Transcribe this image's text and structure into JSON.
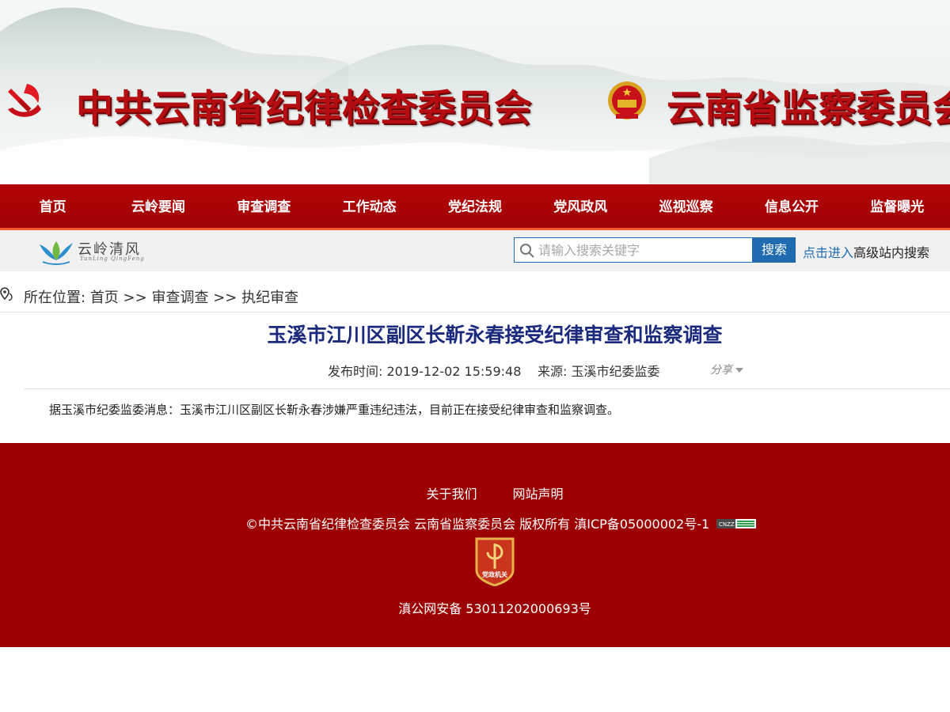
{
  "banner": {
    "title_left": "中共云南省纪律检查委员会",
    "title_right": "云南省监察委员会",
    "party_emblem_icon": "party-emblem-icon",
    "state_emblem_icon": "national-emblem-icon"
  },
  "nav": {
    "items": [
      "首页",
      "云岭要闻",
      "审查调查",
      "工作动态",
      "党纪法规",
      "党风政风",
      "巡视巡察",
      "信息公开",
      "监督曝光"
    ]
  },
  "subbar": {
    "logo_text": "云岭清风",
    "logo_sub": "YunLing QingFeng",
    "search_placeholder": "请输入搜索关键字",
    "search_button": "搜索",
    "advanced_link": "点击进入",
    "advanced_text": "高级站内搜索"
  },
  "breadcrumb": {
    "label": "所在位置:",
    "items": [
      "首页",
      "审查调查",
      "执纪审查"
    ],
    "separator": ">>"
  },
  "article": {
    "title": "玉溪市江川区副区长靳永春接受纪律审查和监察调查",
    "published": "发布时间: 2019-12-02 15:59:48",
    "source": "来源: 玉溪市纪委监委",
    "share": "分享",
    "body": "据玉溪市纪委监委消息：玉溪市江川区副区长靳永春涉嫌严重违纪违法，目前正在接受纪律审查和监察调查。"
  },
  "footer": {
    "links": [
      "关于我们",
      "网站声明"
    ],
    "copyright": "©中共云南省纪律检查委员会 云南省监察委员会 版权所有 滇ICP备05000002号-1",
    "cnzz_text": "CNZZ",
    "badge_text": "党政机关",
    "police_record": "滇公网安备 53011202000693号"
  },
  "colors": {
    "brand_red": "#a00305",
    "title_red": "#b50d12",
    "accent_orange": "#f3562c",
    "link_blue": "#1e6bb0",
    "title_navy": "#1b2a7d",
    "footer_red": "#9c0203"
  }
}
